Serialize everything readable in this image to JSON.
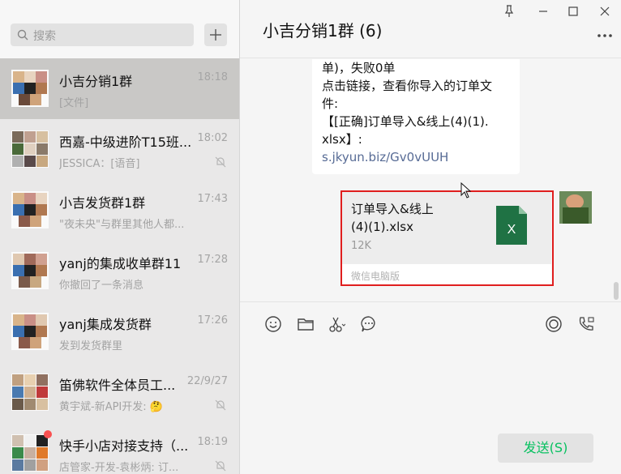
{
  "search": {
    "placeholder": "搜索"
  },
  "chats": [
    {
      "name": "小吉分销1群",
      "time": "18:18",
      "preview": "[文件]",
      "active": true
    },
    {
      "name": "西嘉-中级进阶T15班...",
      "time": "18:02",
      "preview": "JESSICA：[语音]"
    },
    {
      "name": "小吉发货群1群",
      "time": "17:43",
      "preview": "\"夜未央\"与群里其他人都..."
    },
    {
      "name": "yanj的集成收单群11",
      "time": "17:28",
      "preview": "你撤回了一条消息"
    },
    {
      "name": "yanj集成发货群",
      "time": "17:26",
      "preview": "发到发货群里"
    },
    {
      "name": "笛佛软件全体员工...",
      "time": "22/9/27",
      "preview": "黄宇斌-新API开发: 🤔"
    },
    {
      "name": "快手小店对接支持（...",
      "time": "18:19",
      "preview": "店管家-开发-袁彬炳: 订..."
    }
  ],
  "chat": {
    "title": "小吉分销1群 (6)",
    "text_lines": [
      "单)，失败0单",
      "点击链接，查看你导入的订单文",
      "件:",
      "【[正确]订单导入&线上(4)(1).",
      "xlsx】:"
    ],
    "link": "s.jkyun.biz/Gv0vUUH",
    "file": {
      "name_line1": "订单导入&线上",
      "name_line2": "(4)(1).xlsx",
      "size": "12K",
      "source": "微信电脑版",
      "icon_letter": "X"
    }
  },
  "send_label": "发送(S)",
  "colors": {
    "accent": "#07c160",
    "link": "#576b95",
    "highlight": "#e01e1e",
    "excel": "#1f7244"
  }
}
